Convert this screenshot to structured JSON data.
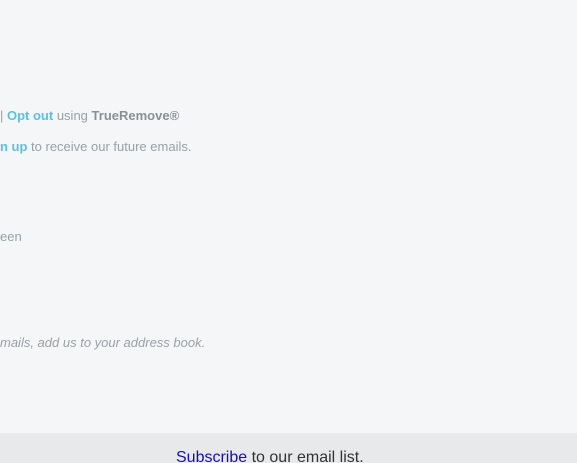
{
  "footer": {
    "line1": {
      "sep": "| ",
      "opt_out_label": "Opt out",
      "using": " using ",
      "brand": "TrueRemove®"
    },
    "line2": {
      "signup_label": "n up",
      "rest": " to receive our future emails."
    },
    "line3": {
      "text": "een"
    },
    "line4": {
      "text": "mails, add us to your address book."
    }
  },
  "subscribe": {
    "link_label": "Subscribe",
    "rest": " to our email list."
  },
  "colors": {
    "link": "#5bc0de",
    "muted_text": "#9aa0a6",
    "background": "#f5f6f8",
    "subscribe_bar": "#e8e9eb",
    "subscribe_link": "#1a0dab"
  }
}
